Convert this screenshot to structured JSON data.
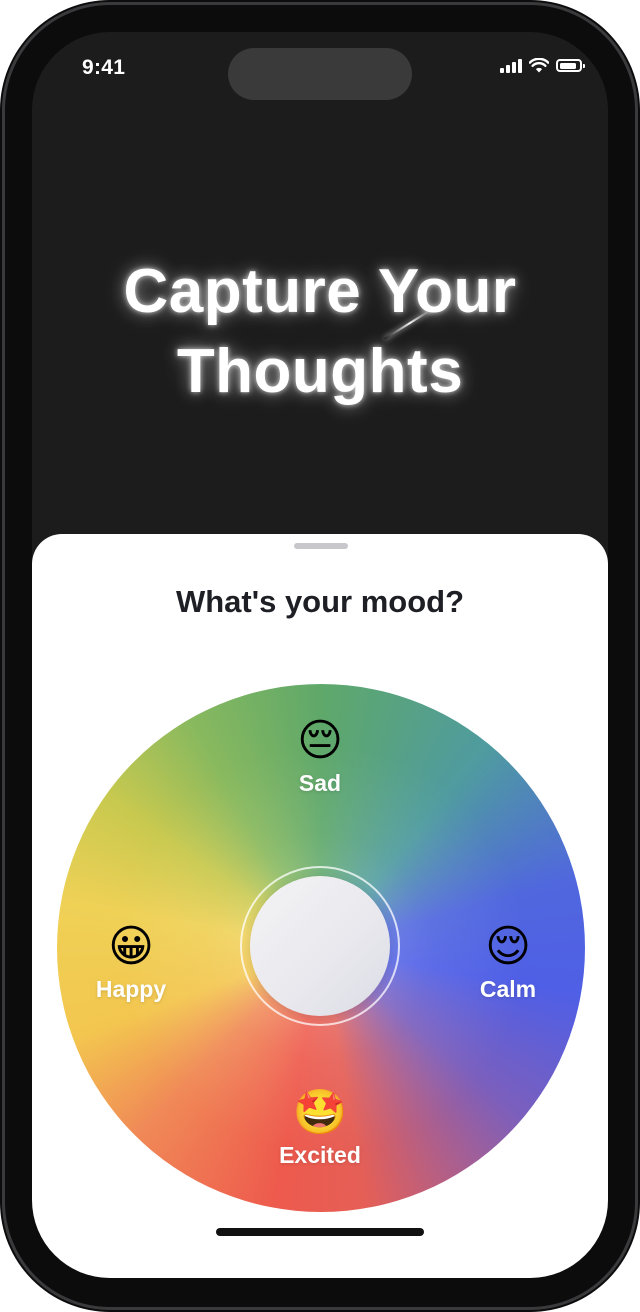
{
  "status_bar": {
    "time": "9:41",
    "signal_icon": "cellular-signal-icon",
    "wifi_icon": "wifi-icon",
    "battery_icon": "battery-icon",
    "battery_level": 0.85
  },
  "hero": {
    "line1": "Capture Your",
    "line2": "Thoughts"
  },
  "sheet": {
    "title": "What's your mood?"
  },
  "moods": [
    {
      "emoji": "😔",
      "label": "Sad",
      "icon": "pensive-face-icon"
    },
    {
      "emoji": "😀",
      "label": "Happy",
      "icon": "grinning-face-icon"
    },
    {
      "emoji": "😌",
      "label": "Calm",
      "icon": "relieved-face-icon"
    },
    {
      "emoji": "🤩",
      "label": "Excited",
      "icon": "star-struck-face-icon"
    }
  ],
  "colors": {
    "background": "#1c1c1c",
    "sheet": "#ffffff",
    "title_text": "#1e1f24",
    "wheel_green": "#5fa86a",
    "wheel_blue": "#4f5fe6",
    "wheel_red": "#ee5a4d",
    "wheel_yellow": "#efd156"
  }
}
